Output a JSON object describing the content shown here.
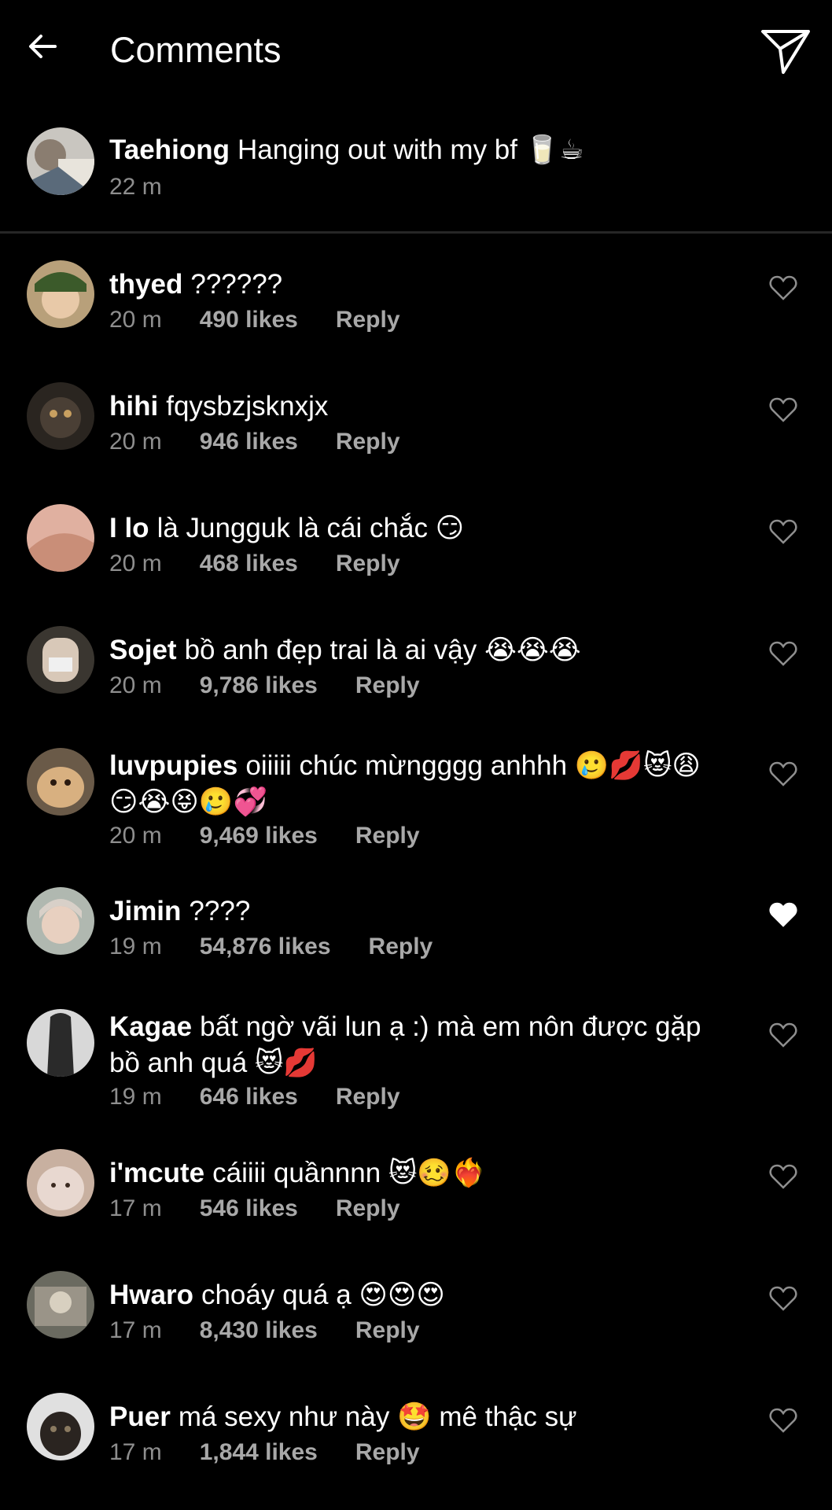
{
  "header": {
    "title": "Comments"
  },
  "caption": {
    "username": "Taehiong",
    "text": "Hanging out with my bf 🥛☕",
    "time": "22 m"
  },
  "comments": [
    {
      "username": "thyed",
      "text": "??????",
      "time": "20 m",
      "likes": "490 likes",
      "reply": "Reply",
      "liked": false
    },
    {
      "username": "hihi",
      "text": "fqysbzjsknxjx",
      "time": "20 m",
      "likes": "946 likes",
      "reply": "Reply",
      "liked": false
    },
    {
      "username": "I lo",
      "text": "là Jungguk là cái chắc 😏",
      "time": "20 m",
      "likes": "468 likes",
      "reply": "Reply",
      "liked": false
    },
    {
      "username": "Sojet",
      "text": "bồ anh đẹp trai là ai vậy 😭😭😭",
      "time": "20 m",
      "likes": "9,786 likes",
      "reply": "Reply",
      "liked": false
    },
    {
      "username": "luvpupies",
      "text": "oiiiii chúc mừngggg anhhh 🥲💋😻😩😏😭😝🥲💞",
      "time": "20 m",
      "likes": "9,469 likes",
      "reply": "Reply",
      "liked": false
    },
    {
      "username": "Jimin",
      "text": "????",
      "time": "19 m",
      "likes": "54,876 likes",
      "reply": "Reply",
      "liked": true
    },
    {
      "username": "Kagae",
      "text": "bất ngờ vãi lun ạ :) mà em nôn được gặp bồ anh quá 😻💋",
      "time": "19 m",
      "likes": "646 likes",
      "reply": "Reply",
      "liked": false
    },
    {
      "username": "i'mcute",
      "text": "cáiiii quầnnnn 😻🥴❤️‍🔥",
      "time": "17 m",
      "likes": "546 likes",
      "reply": "Reply",
      "liked": false
    },
    {
      "username": "Hwaro",
      "text": "choáy quá ạ 😍😍😍",
      "time": "17 m",
      "likes": "8,430 likes",
      "reply": "Reply",
      "liked": false
    },
    {
      "username": "Puer",
      "text": "má sexy như này 🤩 mê thậc sự",
      "time": "17 m",
      "likes": "1,844 likes",
      "reply": "Reply",
      "liked": false
    }
  ],
  "colors": {
    "background": "#000000",
    "text": "#ffffff",
    "meta": "#8e8e8e",
    "divider": "#262626"
  }
}
